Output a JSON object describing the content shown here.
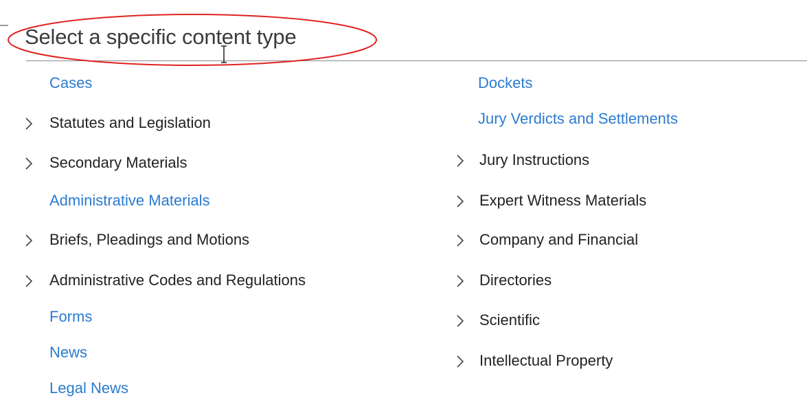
{
  "header": {
    "title": "Select a specific content type"
  },
  "left_column": [
    {
      "label": "Cases",
      "kind": "link"
    },
    {
      "label": "Statutes and Legislation",
      "kind": "expand"
    },
    {
      "label": "Secondary Materials",
      "kind": "expand"
    },
    {
      "label": "Administrative Materials",
      "kind": "link"
    },
    {
      "label": "Briefs, Pleadings and Motions",
      "kind": "expand"
    },
    {
      "label": "Administrative Codes and Regulations",
      "kind": "expand"
    },
    {
      "label": "Forms",
      "kind": "link"
    },
    {
      "label": "News",
      "kind": "link"
    },
    {
      "label": "Legal News",
      "kind": "link"
    }
  ],
  "right_column": [
    {
      "label": "Dockets",
      "kind": "link"
    },
    {
      "label": "Jury Verdicts and Settlements",
      "kind": "link"
    },
    {
      "label": "Jury Instructions",
      "kind": "expand"
    },
    {
      "label": "Expert Witness Materials",
      "kind": "expand"
    },
    {
      "label": "Company and Financial",
      "kind": "expand"
    },
    {
      "label": "Directories",
      "kind": "expand"
    },
    {
      "label": "Scientific",
      "kind": "expand"
    },
    {
      "label": "Intellectual Property",
      "kind": "expand"
    }
  ],
  "colors": {
    "link": "#2b7bd0",
    "text": "#222222",
    "annotation": "#e0231f"
  },
  "icons": {
    "expand": "chevron-right-icon",
    "cursor": "text-cursor-icon"
  }
}
